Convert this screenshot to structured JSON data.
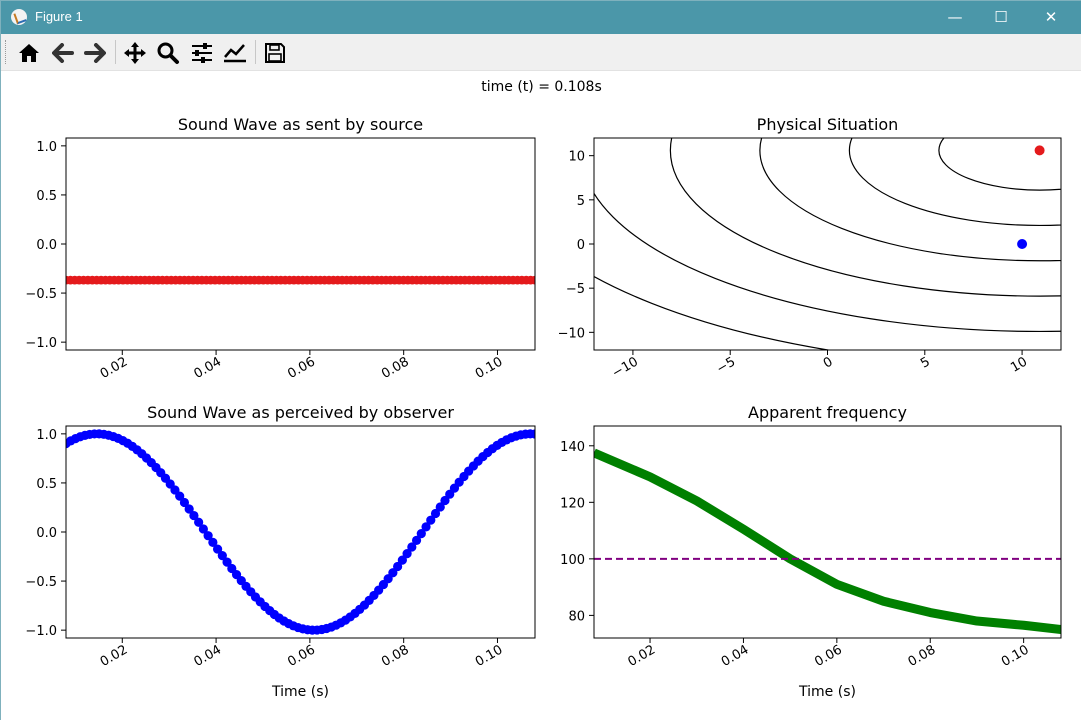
{
  "window": {
    "title": "Figure 1",
    "minimize": "—",
    "maximize": "☐",
    "close": "✕"
  },
  "toolbar": {
    "buttons": [
      {
        "name": "home-icon"
      },
      {
        "name": "back-icon"
      },
      {
        "name": "forward-icon"
      },
      {
        "name": "pan-icon"
      },
      {
        "name": "zoom-icon"
      },
      {
        "name": "configure-subplots-icon"
      },
      {
        "name": "edit-axis-icon"
      },
      {
        "name": "save-icon"
      }
    ]
  },
  "figure": {
    "suptitle": "time (t) = 0.108s"
  },
  "chart_data": [
    {
      "type": "scatter",
      "title": "Sound Wave as sent by source",
      "xlabel": "",
      "ylabel": "",
      "xlim": [
        0.008,
        0.108
      ],
      "ylim": [
        -1.08,
        1.08
      ],
      "xticks": [
        0.02,
        0.04,
        0.06,
        0.08,
        0.1
      ],
      "xtick_labels": [
        "0.02",
        "0.04",
        "0.06",
        "0.08",
        "0.10"
      ],
      "yticks": [
        1.0,
        0.5,
        0.0,
        -0.5,
        -1.0
      ],
      "ytick_labels": [
        "1.0",
        "0.5",
        "0.0",
        "−0.5",
        "−1.0"
      ],
      "series": [
        {
          "frequency": 100,
          "color": "#e41a1c",
          "samples": 108,
          "aliased": true
        }
      ]
    },
    {
      "type": "scatter",
      "title": "Physical Situation",
      "xlabel": "",
      "ylabel": "",
      "xlim": [
        -12,
        12
      ],
      "ylim": [
        -12,
        12
      ],
      "xticks": [
        -10,
        -5,
        0,
        5,
        10
      ],
      "xtick_labels": [
        "−10",
        "−5",
        "0",
        "5",
        "10"
      ],
      "yticks": [
        10,
        5,
        0,
        -5,
        -10
      ],
      "ytick_labels": [
        "10",
        "5",
        "0",
        "−5",
        "−10"
      ],
      "wavefront_radii": [
        4.5,
        8.5,
        12.5,
        16.5,
        20.5,
        24.5
      ],
      "wavefront_center": [
        10.9,
        10.6
      ],
      "points": [
        {
          "role": "source",
          "x": 10.9,
          "y": 10.6,
          "color": "#e41a1c"
        },
        {
          "role": "observer",
          "x": 10.0,
          "y": 0.0,
          "color": "#0000ff"
        }
      ]
    },
    {
      "type": "scatter",
      "title": "Sound Wave as perceived by observer",
      "xlabel": "Time (s)",
      "ylabel": "",
      "xlim": [
        0.008,
        0.108
      ],
      "ylim": [
        -1.08,
        1.08
      ],
      "xticks": [
        0.02,
        0.04,
        0.06,
        0.08,
        0.1
      ],
      "xtick_labels": [
        "0.02",
        "0.04",
        "0.06",
        "0.08",
        "0.10"
      ],
      "yticks": [
        1.0,
        0.5,
        0.0,
        -0.5,
        -1.0
      ],
      "ytick_labels": [
        "1.0",
        "0.5",
        "0.0",
        "−0.5",
        "−1.0"
      ],
      "series": [
        {
          "color": "#0000ff",
          "phase_at_008": 0.39,
          "period_s": 0.0925,
          "samples": 100
        }
      ]
    },
    {
      "type": "line",
      "title": "Apparent frequency",
      "xlabel": "Time (s)",
      "ylabel": "",
      "xlim": [
        0.008,
        0.108
      ],
      "ylim": [
        72,
        147
      ],
      "xticks": [
        0.02,
        0.04,
        0.06,
        0.08,
        0.1
      ],
      "xtick_labels": [
        "0.02",
        "0.04",
        "0.06",
        "0.08",
        "0.10"
      ],
      "yticks": [
        140,
        120,
        100,
        80
      ],
      "ytick_labels": [
        "140",
        "120",
        "100",
        "80"
      ],
      "series": [
        {
          "color": "#008000",
          "x": [
            0.008,
            0.02,
            0.03,
            0.04,
            0.05,
            0.06,
            0.07,
            0.08,
            0.09,
            0.1,
            0.108
          ],
          "y": [
            137.5,
            129,
            120.5,
            110.5,
            100,
            91,
            85,
            81,
            78,
            76.5,
            75
          ]
        },
        {
          "color": "#800080",
          "dashed": true,
          "x": [
            0.008,
            0.108
          ],
          "y": [
            100,
            100
          ]
        }
      ]
    }
  ],
  "ui": {
    "axis_color": "#000000",
    "tick_font_size": 13,
    "title_font_size": 16
  }
}
